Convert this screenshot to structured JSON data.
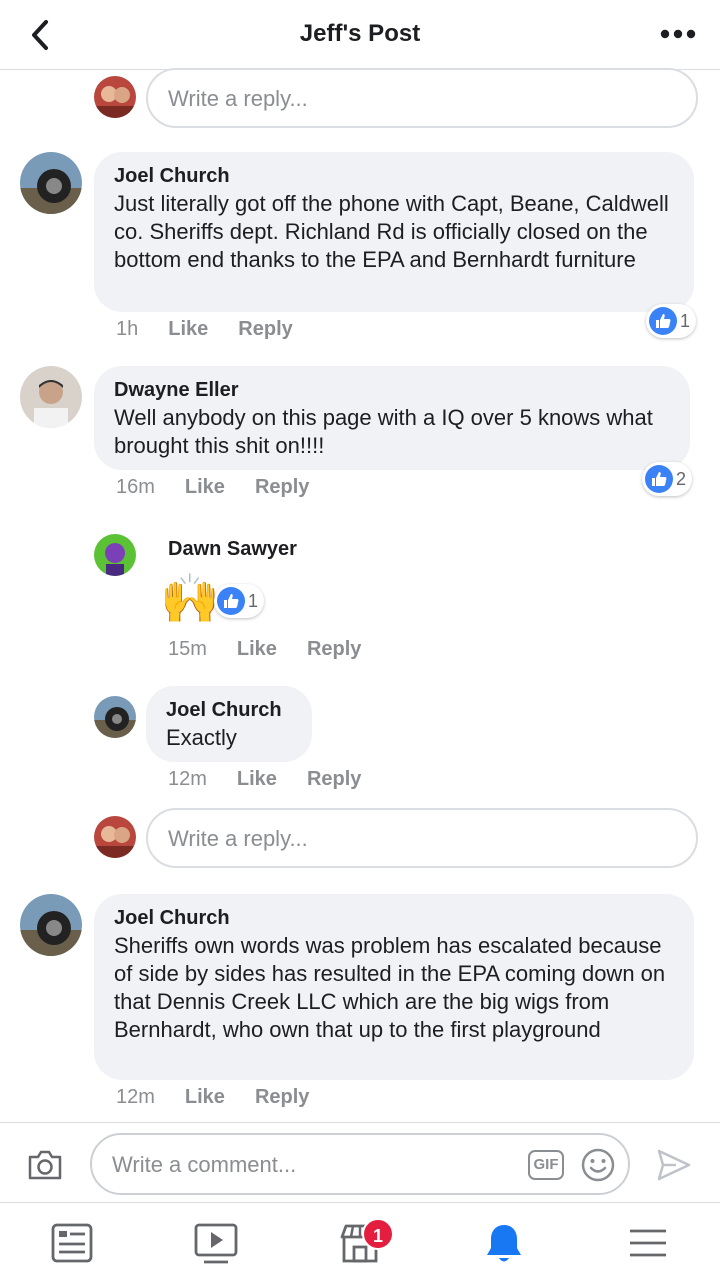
{
  "header": {
    "title": "Jeff's Post"
  },
  "reply_placeholder": "Write a reply...",
  "comments": [
    {
      "name": "Joel Church",
      "text": "Just literally got off the phone with Capt, Beane, Caldwell co. Sheriffs dept. Richland Rd is officially closed on the bottom end thanks to the EPA and Bernhardt furniture",
      "time": "1h",
      "like": "Like",
      "reply": "Reply",
      "reactions": "1"
    },
    {
      "name": "Dwayne Eller",
      "text": "Well anybody on this page with a IQ over 5 knows what brought this shit on!!!!",
      "time": "16m",
      "like": "Like",
      "reply": "Reply",
      "reactions": "2"
    },
    {
      "name": "Joel Church",
      "text": "Sheriffs own words was problem has escalated because of side by sides has resulted in the EPA coming down on that Dennis Creek LLC which are the big wigs from Bernhardt, who own that up to the first playground",
      "time": "12m",
      "like": "Like",
      "reply": "Reply"
    }
  ],
  "replies": [
    {
      "name": "Dawn Sawyer",
      "emoji": "🙌",
      "time": "15m",
      "like": "Like",
      "reply": "Reply",
      "reactions": "1"
    },
    {
      "name": "Joel Church",
      "text": "Exactly",
      "time": "12m",
      "like": "Like",
      "reply": "Reply"
    }
  ],
  "composer": {
    "placeholder": "Write a comment...",
    "gif_label": "GIF"
  },
  "tabbar": {
    "marketplace_badge": "1",
    "active_tab": "notifications"
  },
  "colors": {
    "accent": "#1877f2",
    "bubble": "#f0f2f5",
    "muted": "#8a8d91",
    "badge": "#e41e3f"
  },
  "icons": [
    "back-icon",
    "more-icon",
    "camera-icon",
    "gif-icon",
    "smiley-icon",
    "send-icon",
    "news-feed-icon",
    "watch-icon",
    "marketplace-icon",
    "bell-icon",
    "menu-icon",
    "like-icon"
  ]
}
